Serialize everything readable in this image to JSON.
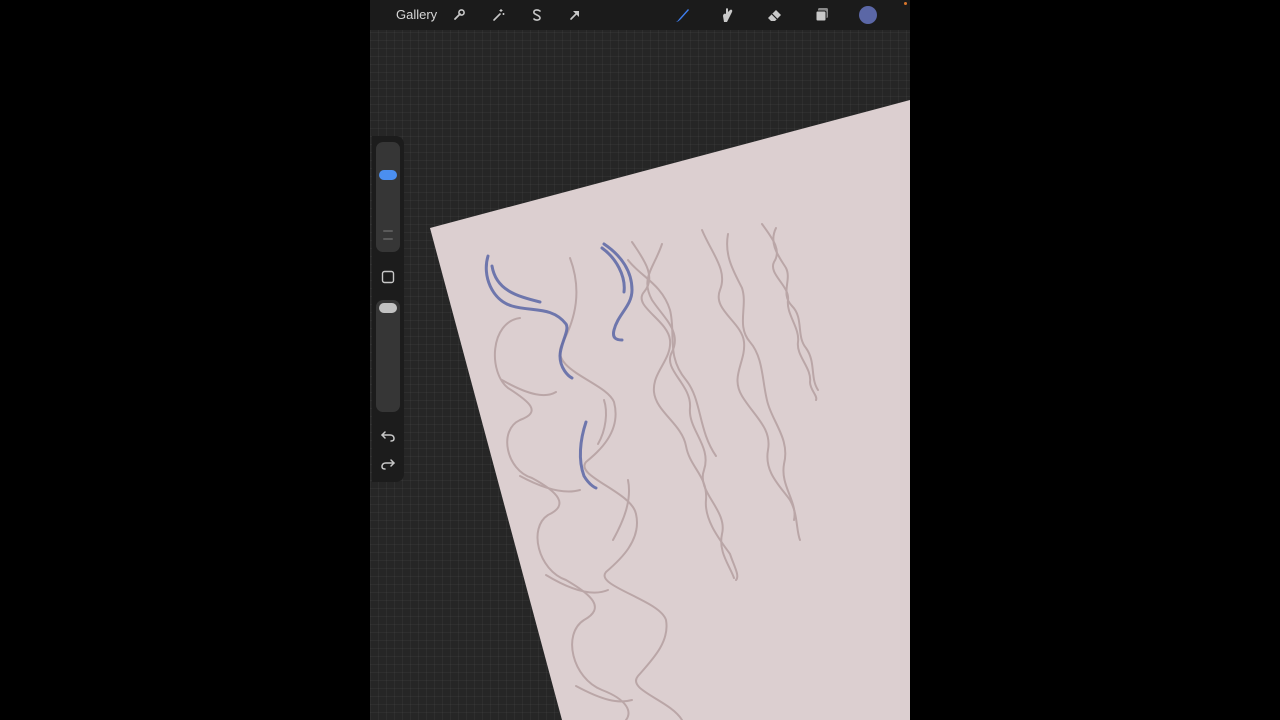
{
  "topbar": {
    "gallery_label": "Gallery",
    "left_tools": [
      "wrench-icon",
      "magic-wand-icon",
      "selection-s-icon",
      "arrow-transform-icon"
    ],
    "right_tools": [
      "brush-icon",
      "smudge-icon",
      "eraser-icon",
      "layers-icon"
    ],
    "active_tool": "brush-icon",
    "current_color": "#5b67a6"
  },
  "sidebar": {
    "brush_size_level": 0.75,
    "brush_opacity_level": 1.0,
    "buttons": [
      "modify-square-icon",
      "undo-icon",
      "redo-icon"
    ]
  },
  "canvas": {
    "paper_color": "#dccfd0",
    "sketch_color": "#b5a0a0",
    "highlight_color": "#5b67a6",
    "background_color": "#262626"
  }
}
